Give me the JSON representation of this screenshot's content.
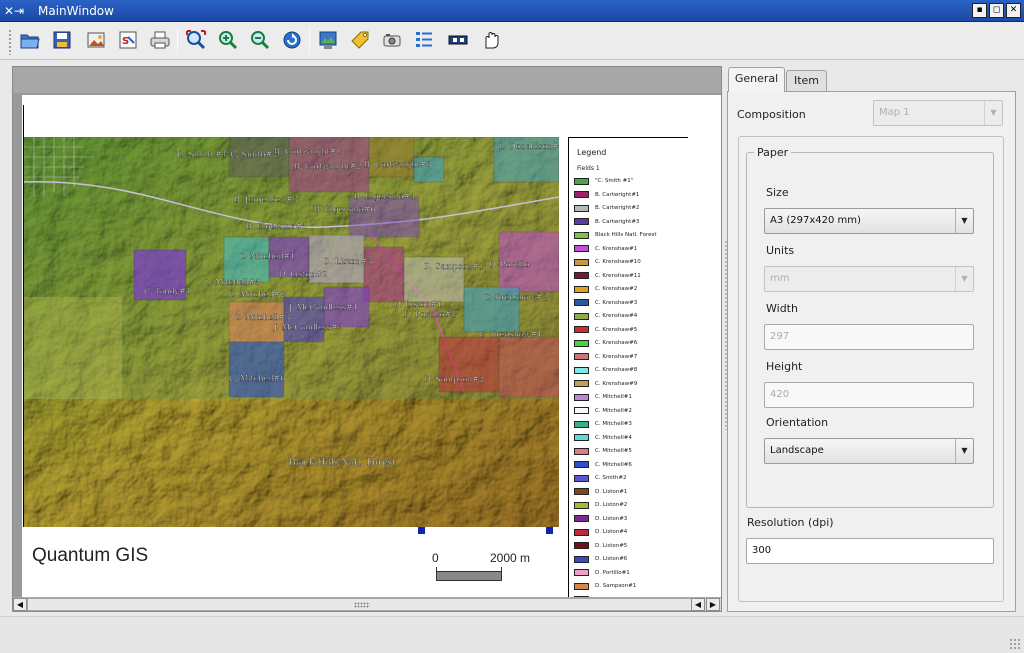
{
  "window": {
    "title": "MainWindow",
    "buttons": {
      "minimize": "▪",
      "maximize": "◻",
      "close": "✕"
    }
  },
  "toolbar": {
    "tools": [
      {
        "name": "open-template-icon",
        "tip": "Open"
      },
      {
        "name": "save-template-icon",
        "tip": "Save"
      },
      {
        "name": "export-image-icon",
        "tip": "Export image"
      },
      {
        "name": "export-svg-icon",
        "tip": "Export SVG"
      },
      {
        "name": "print-icon",
        "tip": "Print"
      },
      {
        "name": "zoom-full-icon",
        "tip": "Zoom full"
      },
      {
        "name": "zoom-in-icon",
        "tip": "Zoom in"
      },
      {
        "name": "zoom-out-icon",
        "tip": "Zoom out"
      },
      {
        "name": "refresh-icon",
        "tip": "Refresh"
      },
      {
        "name": "add-map-icon",
        "tip": "Add map"
      },
      {
        "name": "add-label-icon",
        "tip": "Add label"
      },
      {
        "name": "add-image-icon",
        "tip": "Add image"
      },
      {
        "name": "add-legend-icon",
        "tip": "Add legend"
      },
      {
        "name": "add-scalebar-icon",
        "tip": "Add scalebar"
      },
      {
        "name": "select-move-icon",
        "tip": "Select/Move"
      }
    ]
  },
  "composition": {
    "map_label": "Black Hills Natl. Forest",
    "title_text": "Quantum GIS",
    "scalebar": {
      "zero": "0",
      "end": "2000 m"
    },
    "legend": {
      "title": "Legend",
      "layer": "Fields 1",
      "items": [
        {
          "label": "\"C. Smith #1\"",
          "color": "#4aa84a"
        },
        {
          "label": "B. Cartwright#1",
          "color": "#a0206a"
        },
        {
          "label": "B. Cartwright#2",
          "color": "#b8b8b8"
        },
        {
          "label": "B. Cartwright#3",
          "color": "#5a3ca0"
        },
        {
          "label": "Black Hills Natl. Forest",
          "color": "#7ec24a"
        },
        {
          "label": "C. Krenshaw#1",
          "color": "#c050d8"
        },
        {
          "label": "C. Krenshaw#10",
          "color": "#c89a40"
        },
        {
          "label": "C. Krenshaw#11",
          "color": "#7a1a30"
        },
        {
          "label": "C. Krenshaw#2",
          "color": "#e0a020"
        },
        {
          "label": "C. Krenshaw#3",
          "color": "#2a5aa0"
        },
        {
          "label": "C. Krenshaw#4",
          "color": "#90a850"
        },
        {
          "label": "C. Krenshaw#5",
          "color": "#c83030"
        },
        {
          "label": "C. Krenshaw#6",
          "color": "#40d840"
        },
        {
          "label": "C. Krenshaw#7",
          "color": "#c87878"
        },
        {
          "label": "C. Krenshaw#8",
          "color": "#80e8e8"
        },
        {
          "label": "C. Krenshaw#9",
          "color": "#c0a050"
        },
        {
          "label": "C. Mitchell#1",
          "color": "#b888d0"
        },
        {
          "label": "C. Mitchell#2",
          "color": "#f8f8f8"
        },
        {
          "label": "C. Mitchell#3",
          "color": "#3ab088"
        },
        {
          "label": "C. Mitchell#4",
          "color": "#60d8d8"
        },
        {
          "label": "C. Mitchell#5",
          "color": "#e07890"
        },
        {
          "label": "C. Mitchell#6",
          "color": "#3050c8"
        },
        {
          "label": "C. Smith#2",
          "color": "#5858d0"
        },
        {
          "label": "D. Liston#1",
          "color": "#7a4820"
        },
        {
          "label": "D. Liston#2",
          "color": "#a8b830"
        },
        {
          "label": "D. Liston#3",
          "color": "#7a2a90"
        },
        {
          "label": "D. Liston#4",
          "color": "#c02840"
        },
        {
          "label": "D. Liston#5",
          "color": "#701020"
        },
        {
          "label": "D. Liston#6",
          "color": "#3848c8"
        },
        {
          "label": "D. Portillo#1",
          "color": "#f0a0c8"
        },
        {
          "label": "D. Sampson#1",
          "color": "#d08850"
        },
        {
          "label": "",
          "color": "#60a0a0"
        }
      ]
    },
    "map_labels": [
      "\"C. Smith #1\"C. Smith#2",
      "B. Cartwright#1",
      "B. Cartwright#2",
      "B. Cartwright#3",
      "D. Liston#1",
      "D. Liston#2",
      "D. Liston#3",
      "C. Mitchell#1",
      "C. Mitchell#2",
      "C. Mitchell#3",
      "C. Mitchell#6",
      "C. Krenshaw#1",
      "C. Krenshaw#2",
      "D. Sampson#1",
      "J. McCandless#1",
      "D. Portillo#1",
      "C. Tandy#1",
      "D. Sampson#2"
    ]
  },
  "panel": {
    "tabs": {
      "general": "General",
      "item": "Item"
    },
    "composition_label": "Composition",
    "composition_value": "Map 1",
    "paper_group": "Paper",
    "size_label": "Size",
    "size_value": "A3 (297x420 mm)",
    "units_label": "Units",
    "units_value": "mm",
    "width_label": "Width",
    "width_value": "297",
    "height_label": "Height",
    "height_value": "420",
    "orientation_label": "Orientation",
    "orientation_value": "Landscape",
    "resolution_label": "Resolution (dpi)",
    "resolution_value": "300"
  }
}
